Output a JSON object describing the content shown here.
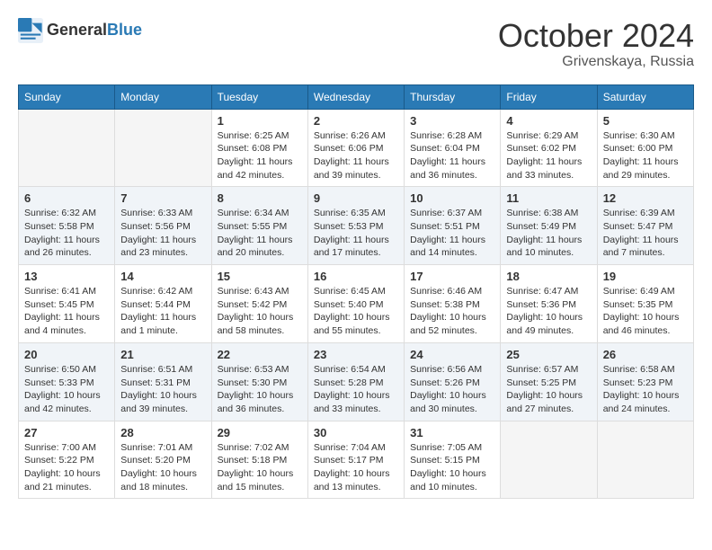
{
  "header": {
    "logo_general": "General",
    "logo_blue": "Blue",
    "month": "October 2024",
    "location": "Grivenskaya, Russia"
  },
  "weekdays": [
    "Sunday",
    "Monday",
    "Tuesday",
    "Wednesday",
    "Thursday",
    "Friday",
    "Saturday"
  ],
  "weeks": [
    [
      {
        "day": "",
        "sunrise": "",
        "sunset": "",
        "daylight": ""
      },
      {
        "day": "",
        "sunrise": "",
        "sunset": "",
        "daylight": ""
      },
      {
        "day": "1",
        "sunrise": "Sunrise: 6:25 AM",
        "sunset": "Sunset: 6:08 PM",
        "daylight": "Daylight: 11 hours and 42 minutes."
      },
      {
        "day": "2",
        "sunrise": "Sunrise: 6:26 AM",
        "sunset": "Sunset: 6:06 PM",
        "daylight": "Daylight: 11 hours and 39 minutes."
      },
      {
        "day": "3",
        "sunrise": "Sunrise: 6:28 AM",
        "sunset": "Sunset: 6:04 PM",
        "daylight": "Daylight: 11 hours and 36 minutes."
      },
      {
        "day": "4",
        "sunrise": "Sunrise: 6:29 AM",
        "sunset": "Sunset: 6:02 PM",
        "daylight": "Daylight: 11 hours and 33 minutes."
      },
      {
        "day": "5",
        "sunrise": "Sunrise: 6:30 AM",
        "sunset": "Sunset: 6:00 PM",
        "daylight": "Daylight: 11 hours and 29 minutes."
      }
    ],
    [
      {
        "day": "6",
        "sunrise": "Sunrise: 6:32 AM",
        "sunset": "Sunset: 5:58 PM",
        "daylight": "Daylight: 11 hours and 26 minutes."
      },
      {
        "day": "7",
        "sunrise": "Sunrise: 6:33 AM",
        "sunset": "Sunset: 5:56 PM",
        "daylight": "Daylight: 11 hours and 23 minutes."
      },
      {
        "day": "8",
        "sunrise": "Sunrise: 6:34 AM",
        "sunset": "Sunset: 5:55 PM",
        "daylight": "Daylight: 11 hours and 20 minutes."
      },
      {
        "day": "9",
        "sunrise": "Sunrise: 6:35 AM",
        "sunset": "Sunset: 5:53 PM",
        "daylight": "Daylight: 11 hours and 17 minutes."
      },
      {
        "day": "10",
        "sunrise": "Sunrise: 6:37 AM",
        "sunset": "Sunset: 5:51 PM",
        "daylight": "Daylight: 11 hours and 14 minutes."
      },
      {
        "day": "11",
        "sunrise": "Sunrise: 6:38 AM",
        "sunset": "Sunset: 5:49 PM",
        "daylight": "Daylight: 11 hours and 10 minutes."
      },
      {
        "day": "12",
        "sunrise": "Sunrise: 6:39 AM",
        "sunset": "Sunset: 5:47 PM",
        "daylight": "Daylight: 11 hours and 7 minutes."
      }
    ],
    [
      {
        "day": "13",
        "sunrise": "Sunrise: 6:41 AM",
        "sunset": "Sunset: 5:45 PM",
        "daylight": "Daylight: 11 hours and 4 minutes."
      },
      {
        "day": "14",
        "sunrise": "Sunrise: 6:42 AM",
        "sunset": "Sunset: 5:44 PM",
        "daylight": "Daylight: 11 hours and 1 minute."
      },
      {
        "day": "15",
        "sunrise": "Sunrise: 6:43 AM",
        "sunset": "Sunset: 5:42 PM",
        "daylight": "Daylight: 10 hours and 58 minutes."
      },
      {
        "day": "16",
        "sunrise": "Sunrise: 6:45 AM",
        "sunset": "Sunset: 5:40 PM",
        "daylight": "Daylight: 10 hours and 55 minutes."
      },
      {
        "day": "17",
        "sunrise": "Sunrise: 6:46 AM",
        "sunset": "Sunset: 5:38 PM",
        "daylight": "Daylight: 10 hours and 52 minutes."
      },
      {
        "day": "18",
        "sunrise": "Sunrise: 6:47 AM",
        "sunset": "Sunset: 5:36 PM",
        "daylight": "Daylight: 10 hours and 49 minutes."
      },
      {
        "day": "19",
        "sunrise": "Sunrise: 6:49 AM",
        "sunset": "Sunset: 5:35 PM",
        "daylight": "Daylight: 10 hours and 46 minutes."
      }
    ],
    [
      {
        "day": "20",
        "sunrise": "Sunrise: 6:50 AM",
        "sunset": "Sunset: 5:33 PM",
        "daylight": "Daylight: 10 hours and 42 minutes."
      },
      {
        "day": "21",
        "sunrise": "Sunrise: 6:51 AM",
        "sunset": "Sunset: 5:31 PM",
        "daylight": "Daylight: 10 hours and 39 minutes."
      },
      {
        "day": "22",
        "sunrise": "Sunrise: 6:53 AM",
        "sunset": "Sunset: 5:30 PM",
        "daylight": "Daylight: 10 hours and 36 minutes."
      },
      {
        "day": "23",
        "sunrise": "Sunrise: 6:54 AM",
        "sunset": "Sunset: 5:28 PM",
        "daylight": "Daylight: 10 hours and 33 minutes."
      },
      {
        "day": "24",
        "sunrise": "Sunrise: 6:56 AM",
        "sunset": "Sunset: 5:26 PM",
        "daylight": "Daylight: 10 hours and 30 minutes."
      },
      {
        "day": "25",
        "sunrise": "Sunrise: 6:57 AM",
        "sunset": "Sunset: 5:25 PM",
        "daylight": "Daylight: 10 hours and 27 minutes."
      },
      {
        "day": "26",
        "sunrise": "Sunrise: 6:58 AM",
        "sunset": "Sunset: 5:23 PM",
        "daylight": "Daylight: 10 hours and 24 minutes."
      }
    ],
    [
      {
        "day": "27",
        "sunrise": "Sunrise: 7:00 AM",
        "sunset": "Sunset: 5:22 PM",
        "daylight": "Daylight: 10 hours and 21 minutes."
      },
      {
        "day": "28",
        "sunrise": "Sunrise: 7:01 AM",
        "sunset": "Sunset: 5:20 PM",
        "daylight": "Daylight: 10 hours and 18 minutes."
      },
      {
        "day": "29",
        "sunrise": "Sunrise: 7:02 AM",
        "sunset": "Sunset: 5:18 PM",
        "daylight": "Daylight: 10 hours and 15 minutes."
      },
      {
        "day": "30",
        "sunrise": "Sunrise: 7:04 AM",
        "sunset": "Sunset: 5:17 PM",
        "daylight": "Daylight: 10 hours and 13 minutes."
      },
      {
        "day": "31",
        "sunrise": "Sunrise: 7:05 AM",
        "sunset": "Sunset: 5:15 PM",
        "daylight": "Daylight: 10 hours and 10 minutes."
      },
      {
        "day": "",
        "sunrise": "",
        "sunset": "",
        "daylight": ""
      },
      {
        "day": "",
        "sunrise": "",
        "sunset": "",
        "daylight": ""
      }
    ]
  ]
}
